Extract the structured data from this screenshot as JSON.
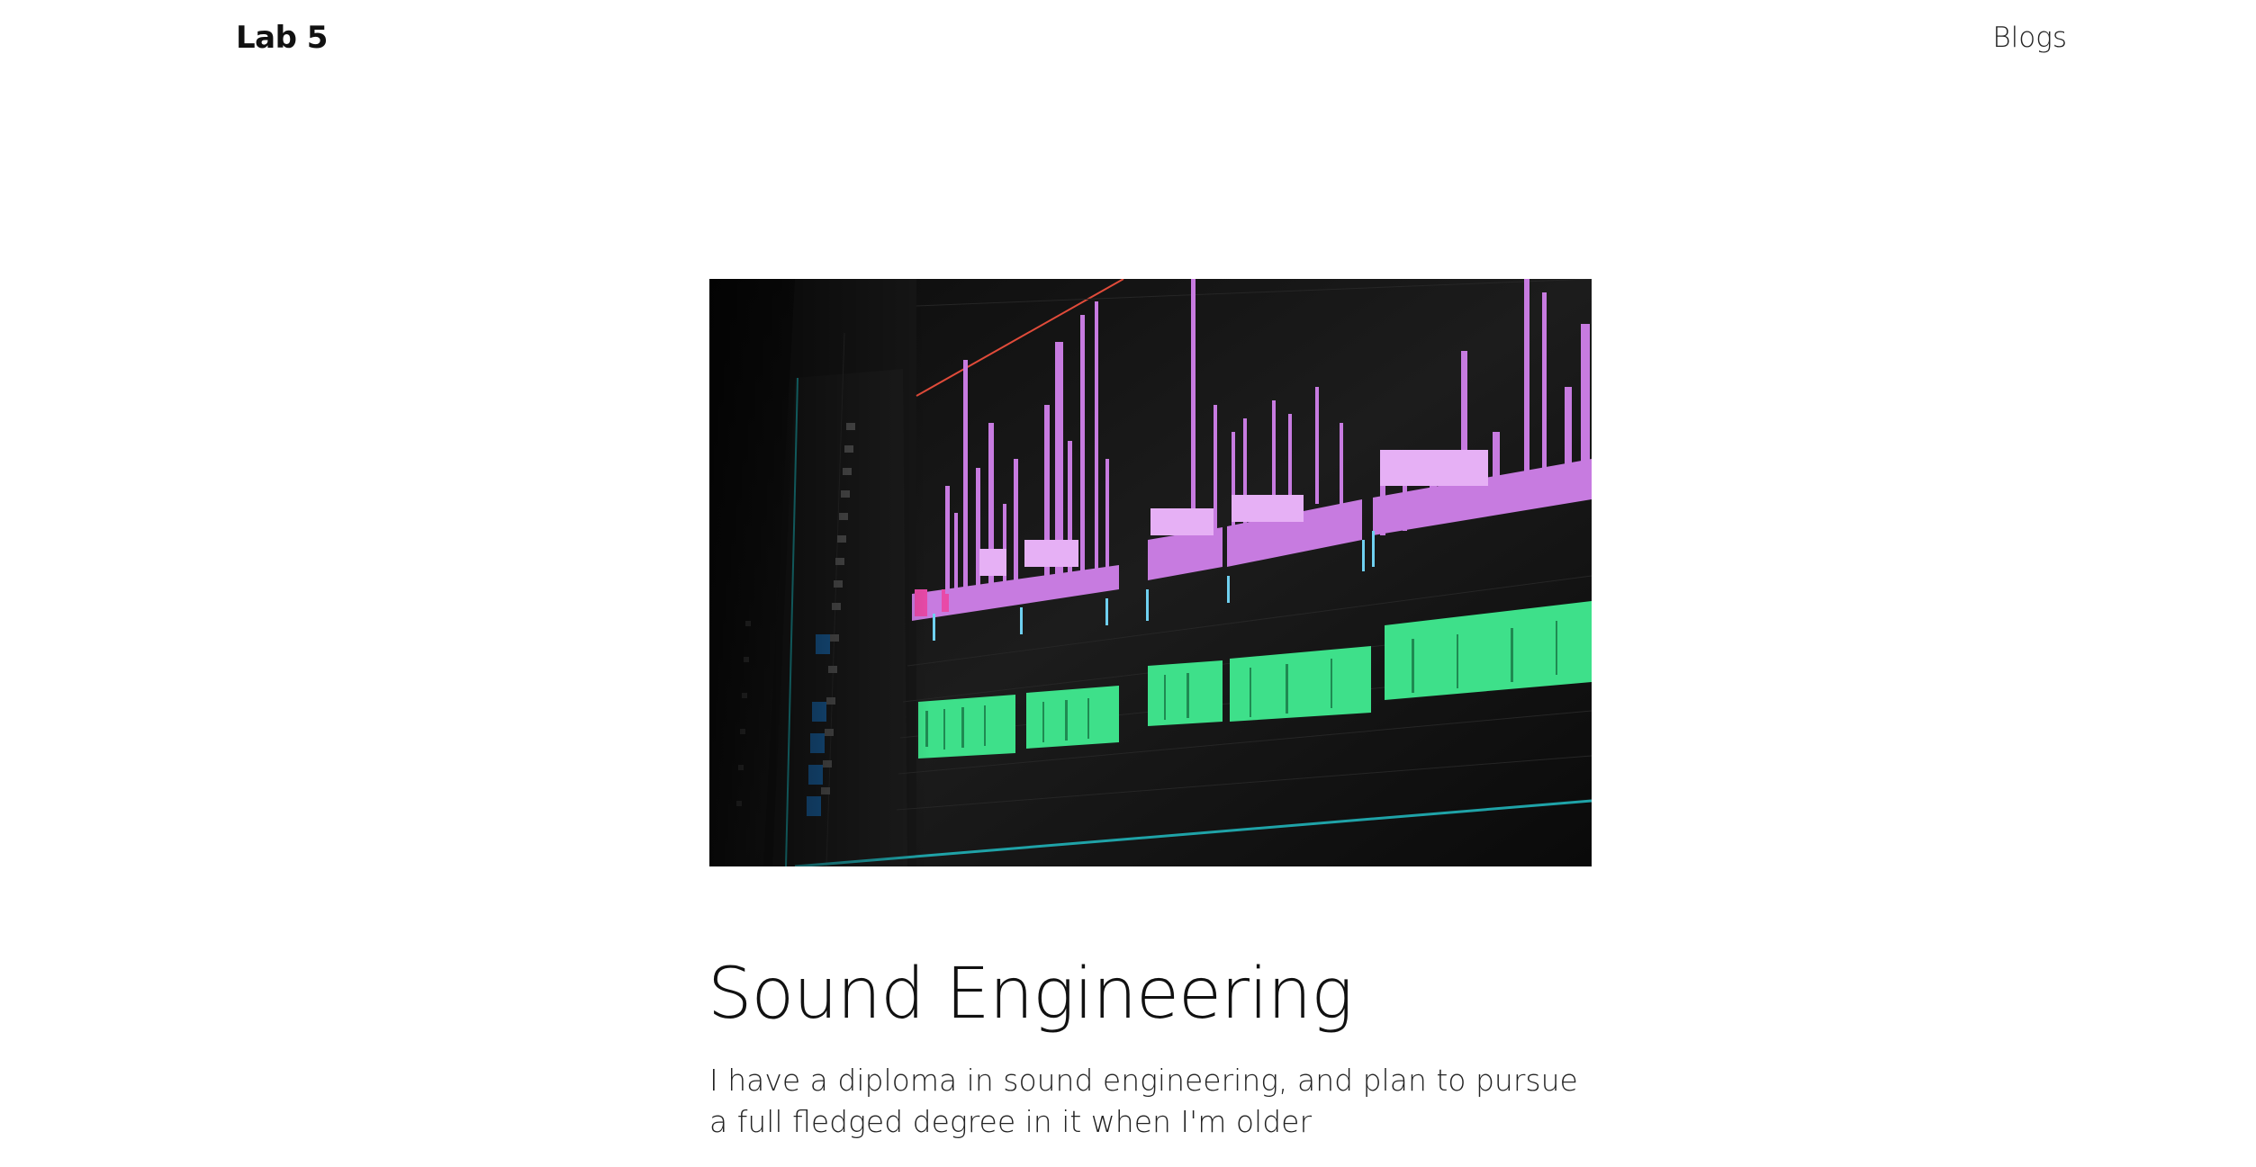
{
  "nav": {
    "brand": "Lab 5",
    "links": [
      "Blogs"
    ]
  },
  "post": {
    "image_alt": "Audio editing timeline",
    "title": "Sound Engineering",
    "description": "I have a diploma in sound engineering, and plan to pursue a full fledged degree in it when I'm older"
  },
  "colors": {
    "background": "#ffffff",
    "text": "#111111",
    "clip_purple": "#c77be0",
    "clip_green": "#3ee08a",
    "timeline_teal": "#1fa3a8"
  }
}
